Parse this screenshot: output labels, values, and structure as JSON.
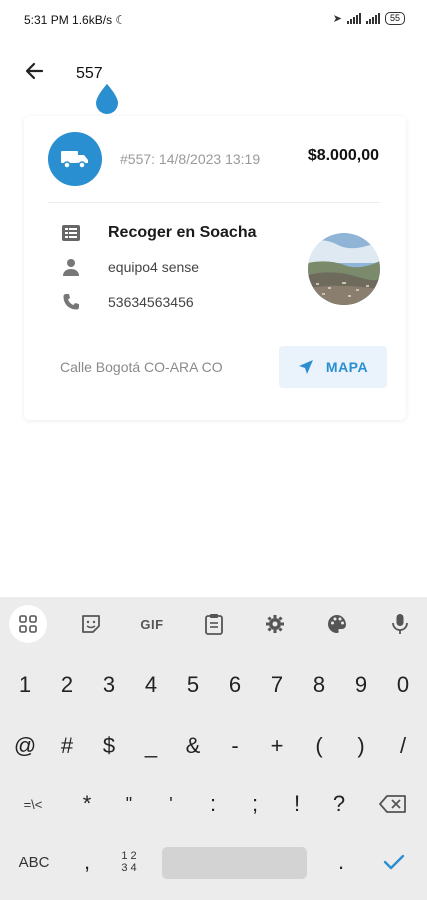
{
  "status_bar": {
    "time": "5:31 PM",
    "speed": "1.6kB/s",
    "battery": "55"
  },
  "search": {
    "value": "557"
  },
  "order": {
    "meta": "#557: 14/8/2023 13:19",
    "amount": "$8.000,00",
    "title": "Recoger en Soacha",
    "user": "equipo4 sense",
    "phone": "53634563456",
    "address": "Calle Bogotá CO-ARA CO",
    "map_label": "MAPA"
  },
  "colors": {
    "accent": "#2a8fd0",
    "map_button_bg": "#eaf3fb"
  },
  "keyboard": {
    "toolbar_gif": "GIF",
    "row1": [
      "1",
      "2",
      "3",
      "4",
      "5",
      "6",
      "7",
      "8",
      "9",
      "0"
    ],
    "row2": [
      "@",
      "#",
      "$",
      "_",
      "&",
      "-",
      "+",
      "(",
      ")",
      "/"
    ],
    "row3": [
      "=\\<",
      "*",
      "\"",
      "'",
      ":",
      ";",
      "!",
      "?"
    ],
    "abc": "ABC",
    "comma": ",",
    "numpad_top": "1 2",
    "numpad_bottom": "3 4",
    "period": "."
  }
}
